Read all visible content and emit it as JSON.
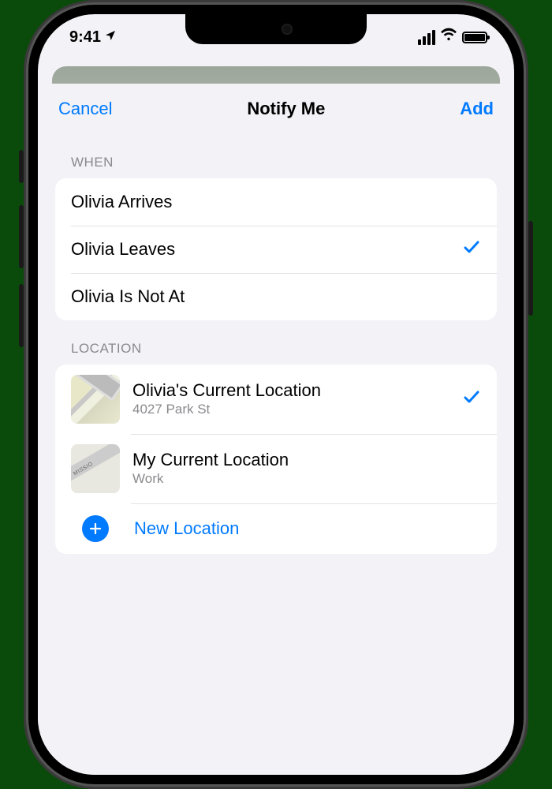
{
  "status": {
    "time": "9:41"
  },
  "nav": {
    "cancel": "Cancel",
    "title": "Notify Me",
    "add": "Add"
  },
  "sections": {
    "when": {
      "header": "WHEN",
      "options": [
        {
          "label": "Olivia Arrives",
          "selected": false
        },
        {
          "label": "Olivia Leaves",
          "selected": true
        },
        {
          "label": "Olivia Is Not At",
          "selected": false
        }
      ]
    },
    "location": {
      "header": "LOCATION",
      "items": [
        {
          "title": "Olivia's Current Location",
          "subtitle": "4027 Park St",
          "selected": true
        },
        {
          "title": "My Current Location",
          "subtitle": "Work",
          "selected": false
        }
      ],
      "new_location_label": "New Location"
    }
  },
  "colors": {
    "accent": "#007aff",
    "sheet_bg": "#f2f2f7",
    "secondary_text": "#8a8a8e"
  }
}
